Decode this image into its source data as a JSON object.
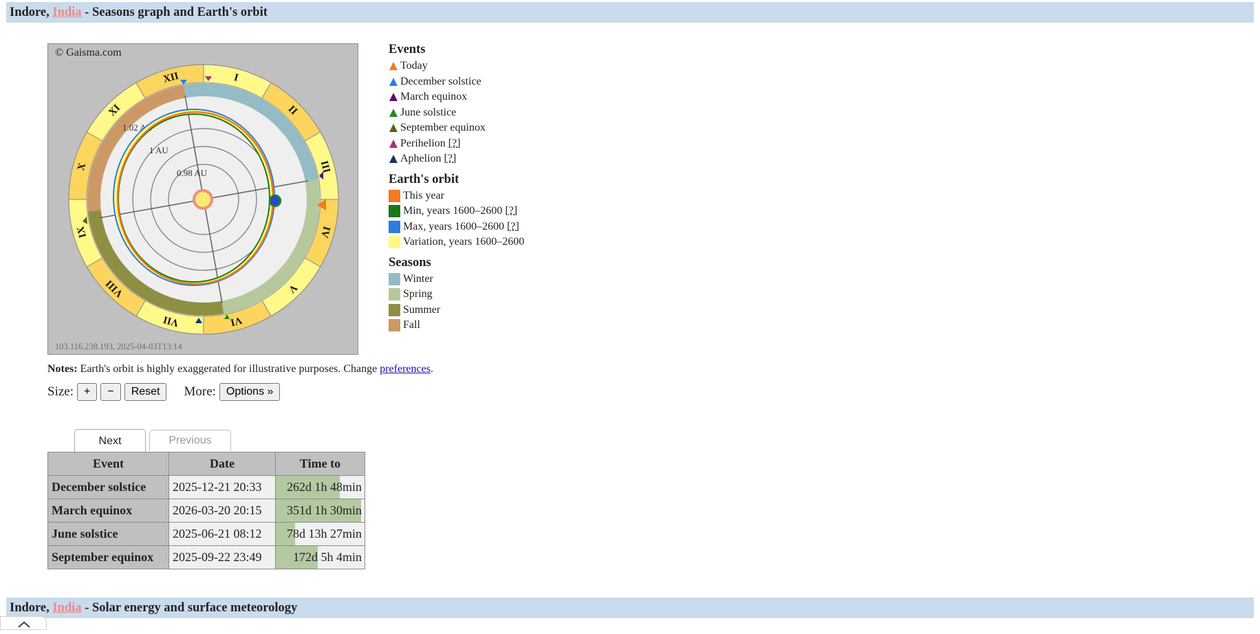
{
  "header1": {
    "city": "Indore",
    "country": "India",
    "rest": " - Seasons graph and Earth's orbit"
  },
  "header2": {
    "city": "Indore",
    "country": "India",
    "rest": " - Solar energy and surface meteorology"
  },
  "graph": {
    "copyright": "© Gaisma.com",
    "ip_stamp": "103.116.238.193, 2025-04-03T13:14",
    "months": [
      "I",
      "II",
      "III",
      "IV",
      "V",
      "VI",
      "VII",
      "VIII",
      "IX",
      "X",
      "XI",
      "XII"
    ],
    "au_labels": {
      "outer": "1.02 AU",
      "middle": "1 AU",
      "inner": "0.98 AU"
    }
  },
  "legend": {
    "events": {
      "title": "Events",
      "items": [
        {
          "label": "Today",
          "color": "#f4791f"
        },
        {
          "label": "December solstice",
          "color": "#2b7de0"
        },
        {
          "label": "March equinox",
          "color": "#5a0a6e"
        },
        {
          "label": "June solstice",
          "color": "#1f8a1f"
        },
        {
          "label": "September equinox",
          "color": "#5e6312"
        },
        {
          "label": "Perihelion",
          "help": "[?]",
          "color": "#a8327a"
        },
        {
          "label": "Aphelion",
          "help": "[?]",
          "color": "#10385e"
        }
      ]
    },
    "orbit": {
      "title": "Earth's orbit",
      "items": [
        {
          "label": "This year",
          "color": "#f4791f"
        },
        {
          "label": "Min, years 1600–2600",
          "help": "[?]",
          "color": "#1a7a1a"
        },
        {
          "label": "Max, years 1600–2600",
          "help": "[?]",
          "color": "#2b7de0"
        },
        {
          "label": "Variation, years 1600–2600",
          "color": "#fffa82"
        }
      ]
    },
    "seasons": {
      "title": "Seasons",
      "items": [
        {
          "label": "Winter",
          "color": "#94bcc4"
        },
        {
          "label": "Spring",
          "color": "#b6c99c"
        },
        {
          "label": "Summer",
          "color": "#8f8f44"
        },
        {
          "label": "Fall",
          "color": "#cc9966"
        }
      ]
    }
  },
  "notes": {
    "bold": "Notes:",
    "text": " Earth's orbit is highly exaggerated for illustrative purposes. Change ",
    "link": "preferences",
    "end": "."
  },
  "controls": {
    "size_label": "Size:",
    "plus": "+",
    "minus": "−",
    "reset": "Reset",
    "more_label": "More:",
    "options": "Options »"
  },
  "tabs": {
    "next": "Next",
    "previous": "Previous"
  },
  "table": {
    "headers": [
      "Event",
      "Date",
      "Time to"
    ],
    "rows": [
      {
        "event": "December solstice",
        "date": "2025-12-21 20:33",
        "time_to": "262d 1h 48min",
        "progress": 0.72
      },
      {
        "event": "March equinox",
        "date": "2026-03-20 20:15",
        "time_to": "351d 1h 30min",
        "progress": 0.96
      },
      {
        "event": "June solstice",
        "date": "2025-06-21 08:12",
        "time_to": "78d 13h 27min",
        "progress": 0.22
      },
      {
        "event": "September equinox",
        "date": "2025-09-22 23:49",
        "time_to": "172d 5h 4min",
        "progress": 0.47
      }
    ]
  }
}
